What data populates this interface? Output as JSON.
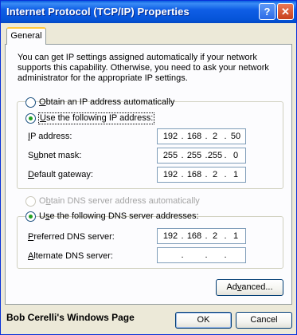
{
  "window": {
    "title": "Internet Protocol (TCP/IP) Properties",
    "help_glyph": "?",
    "close_glyph": "✕"
  },
  "tabs": [
    {
      "label": "General",
      "active": true
    }
  ],
  "info_text": "You can get IP settings assigned automatically if your network supports this capability. Otherwise, you need to ask your network administrator for the appropriate IP settings.",
  "ip_section": {
    "auto_label": "Obtain an IP address automatically",
    "manual_label": "Use the following IP address:",
    "selected": "manual",
    "fields": [
      {
        "label": "IP address:",
        "octets": [
          "192",
          "168",
          "2",
          "50"
        ]
      },
      {
        "label": "Subnet mask:",
        "octets": [
          "255",
          "255",
          "255",
          "0"
        ]
      },
      {
        "label": "Default gateway:",
        "octets": [
          "192",
          "168",
          "2",
          "1"
        ]
      }
    ]
  },
  "dns_section": {
    "auto_label": "Obtain DNS server address automatically",
    "manual_label": "Use the following DNS server addresses:",
    "selected": "manual",
    "fields": [
      {
        "label": "Preferred DNS server:",
        "octets": [
          "192",
          "168",
          "2",
          "1"
        ]
      },
      {
        "label": "Alternate DNS server:",
        "octets": [
          "",
          "",
          "",
          ""
        ]
      }
    ]
  },
  "buttons": {
    "advanced": "Advanced...",
    "ok": "OK",
    "cancel": "Cancel"
  },
  "footer_text": "Bob Cerelli's Windows Page"
}
